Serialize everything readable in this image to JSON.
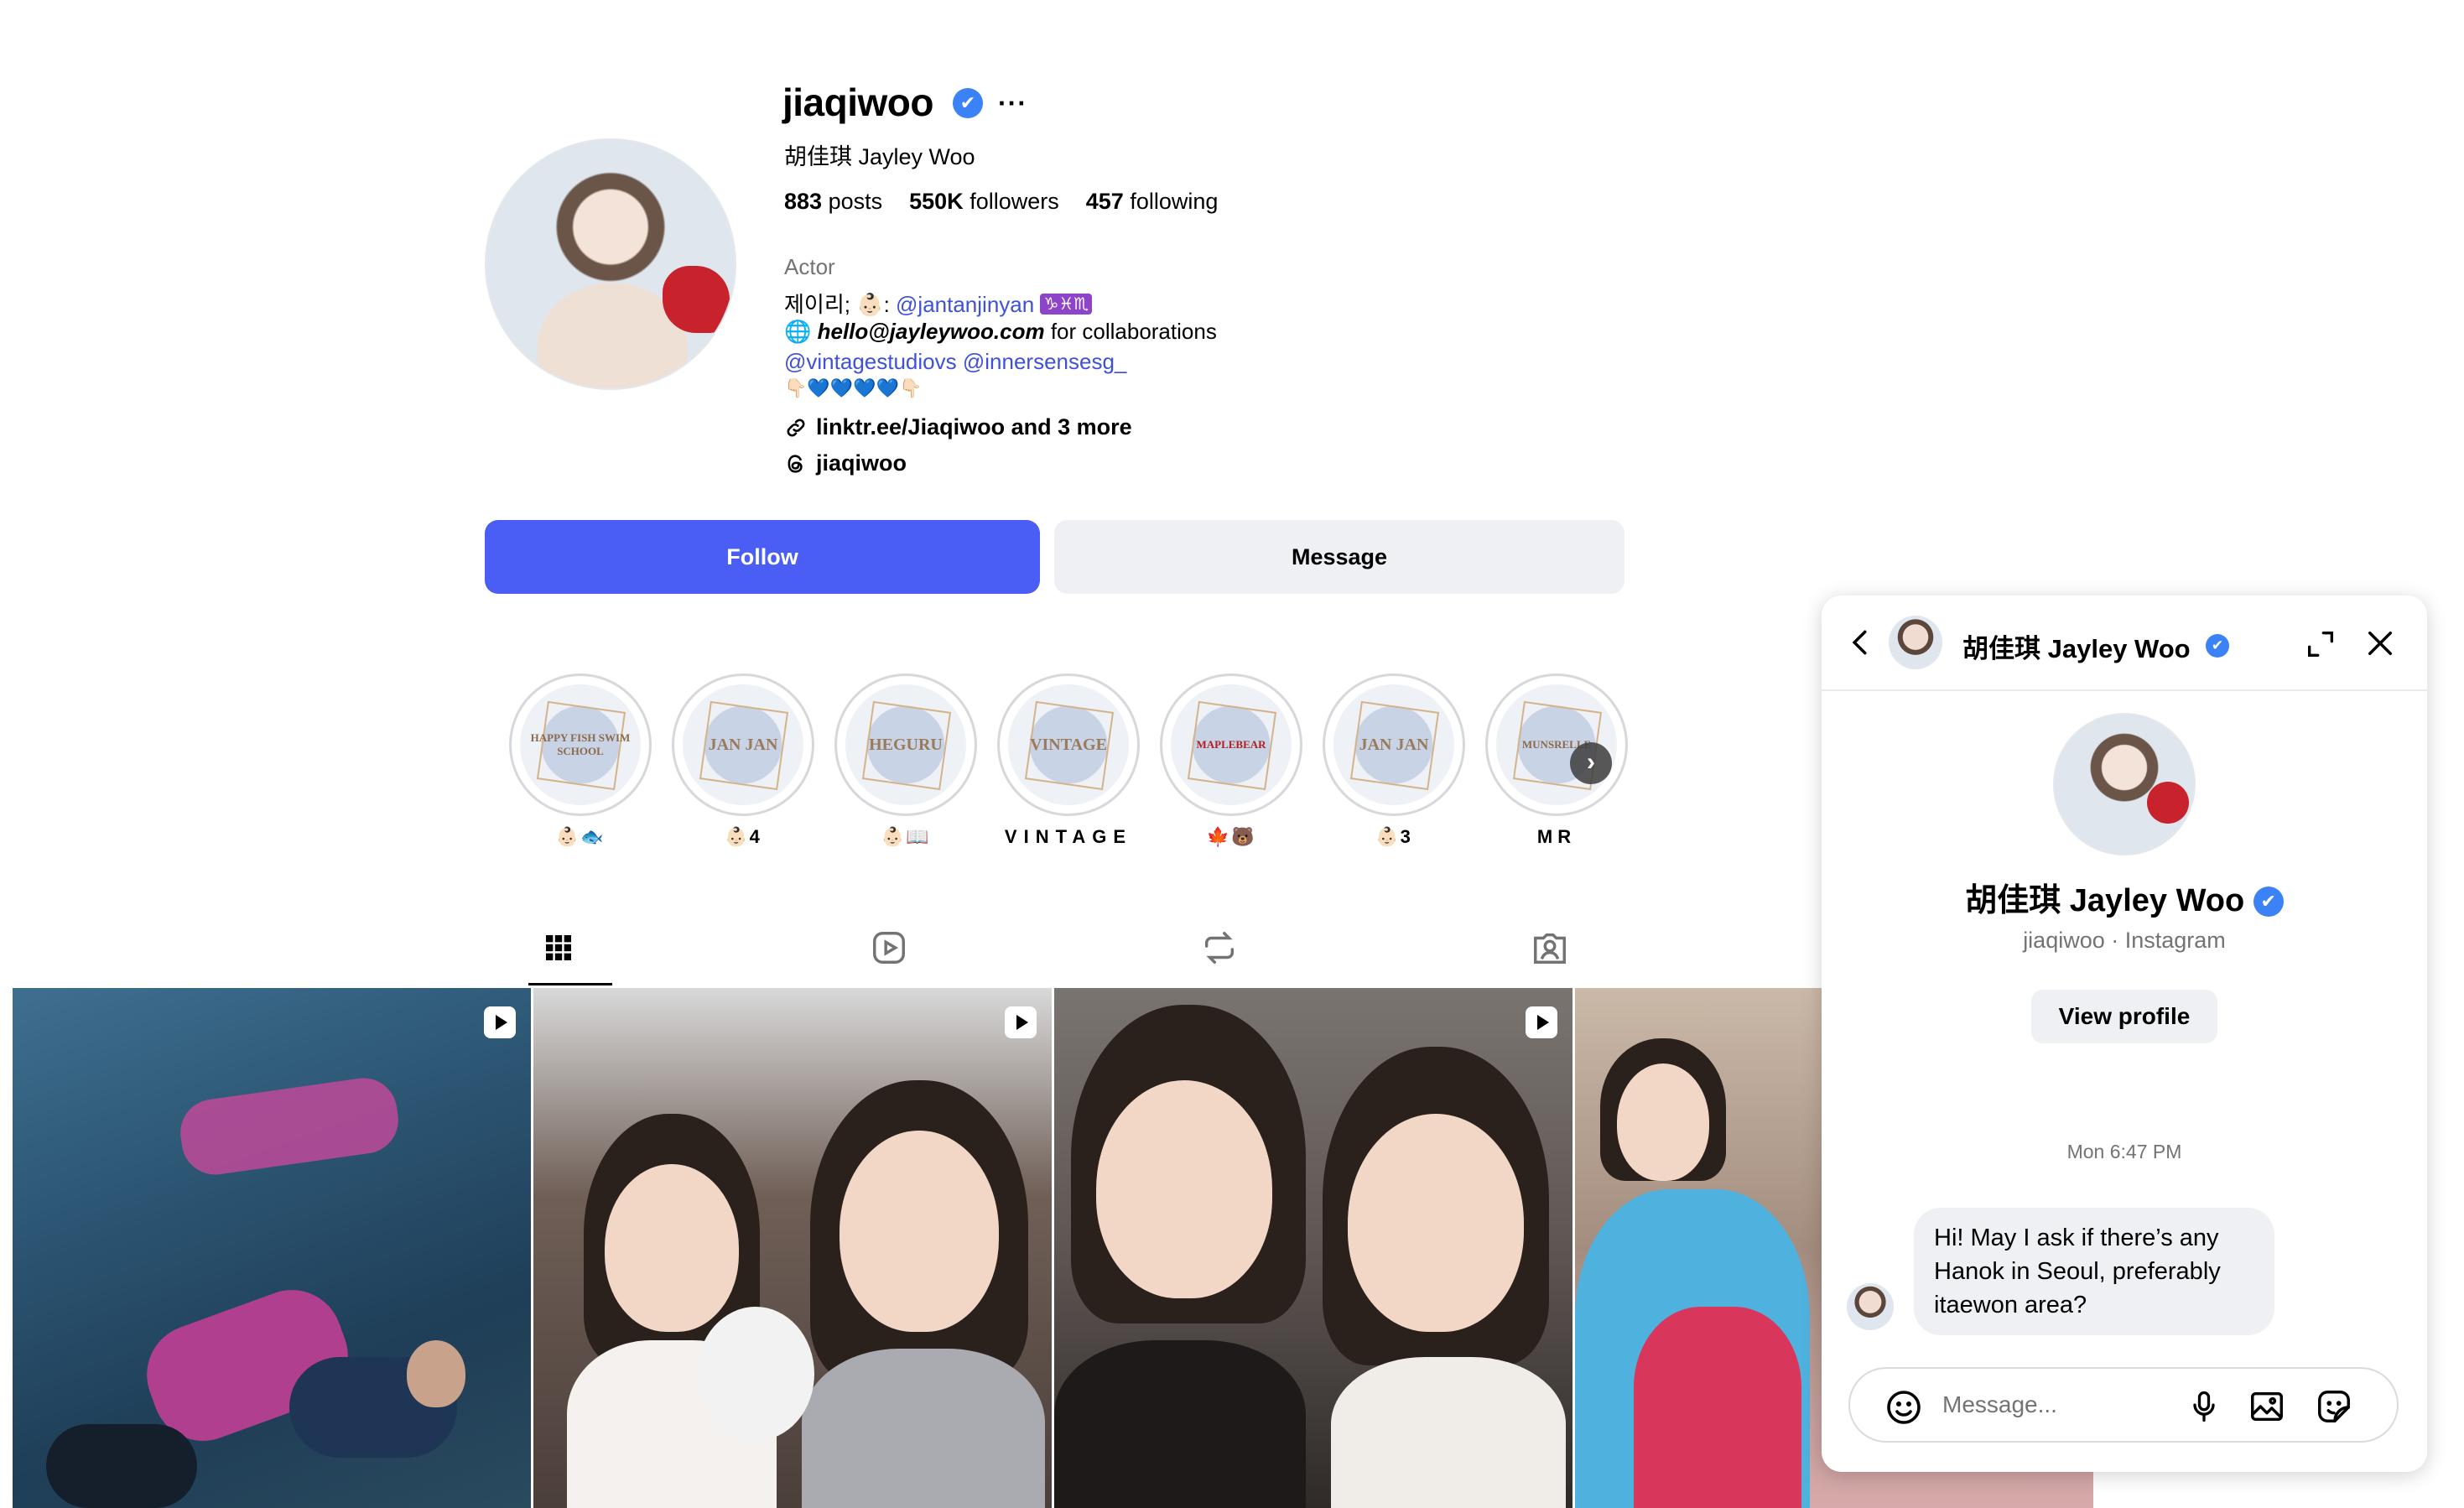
{
  "profile": {
    "username": "jiaqiwoo",
    "more_label": "···",
    "full_name": "胡佳琪 Jayley Woo",
    "stats": {
      "posts_count": "883",
      "posts_label": "posts",
      "followers_count": "550K",
      "followers_label": "followers",
      "following_count": "457",
      "following_label": "following"
    },
    "category": "Actor",
    "bio": {
      "line1_prefix": "제이리; 👶🏻: ",
      "line1_mention": "@jantanjinyan",
      "line1_zodiac": "♑♓♏",
      "line2_globe": "🌐",
      "line2_email": "hello@jayleywoo.com",
      "line2_suffix": " for collaborations",
      "line3_mention1": "@vintagestudiovs",
      "line3_mention2": "@innersensesg_",
      "line4": "👇🏻💙💙💙💙👇🏻"
    },
    "link_text": "linktr.ee/Jiaqiwoo and 3 more",
    "threads_text": "jiaqiwoo"
  },
  "actions": {
    "follow_label": "Follow",
    "message_label": "Message"
  },
  "highlights": [
    {
      "cover_text": "HAPPY FISH SWIM SCHOOL",
      "label": "👶🏻🐟"
    },
    {
      "cover_text": "JAN JAN",
      "label": "👶🏻4"
    },
    {
      "cover_text": "HEGURU",
      "label": "👶🏻📖"
    },
    {
      "cover_text": "VINTAGE",
      "label": "VINTAGE"
    },
    {
      "cover_text": "MAPLEBEAR",
      "label": "🍁🐻"
    },
    {
      "cover_text": "JAN JAN",
      "label": "👶🏻3"
    },
    {
      "cover_text": "MUNSRELLE",
      "label": "MR"
    }
  ],
  "highlights_next": "›",
  "tabs": [
    "posts-grid",
    "reels",
    "reposts",
    "tagged"
  ],
  "chat": {
    "header_name": "胡佳琪 Jayley Woo",
    "title": "胡佳琪 Jayley Woo",
    "subtitle": "jiaqiwoo · Instagram",
    "view_profile_label": "View profile",
    "timestamp": "Mon 6:47 PM",
    "message": "Hi! May I ask if there’s any Hanok in Seoul, preferably itaewon area?",
    "input_placeholder": "Message..."
  },
  "colors": {
    "follow_button": "#4a5df5",
    "verified_badge": "#3b82f6",
    "link_blue": "#3f51d6",
    "secondary_button": "#eff0f3"
  },
  "icons": {
    "verified": "✔",
    "link": "link-icon",
    "threads": "threads-icon",
    "grid": "grid-icon",
    "reels": "reels-icon",
    "reposts": "repost-icon",
    "tagged": "tagged-icon"
  }
}
